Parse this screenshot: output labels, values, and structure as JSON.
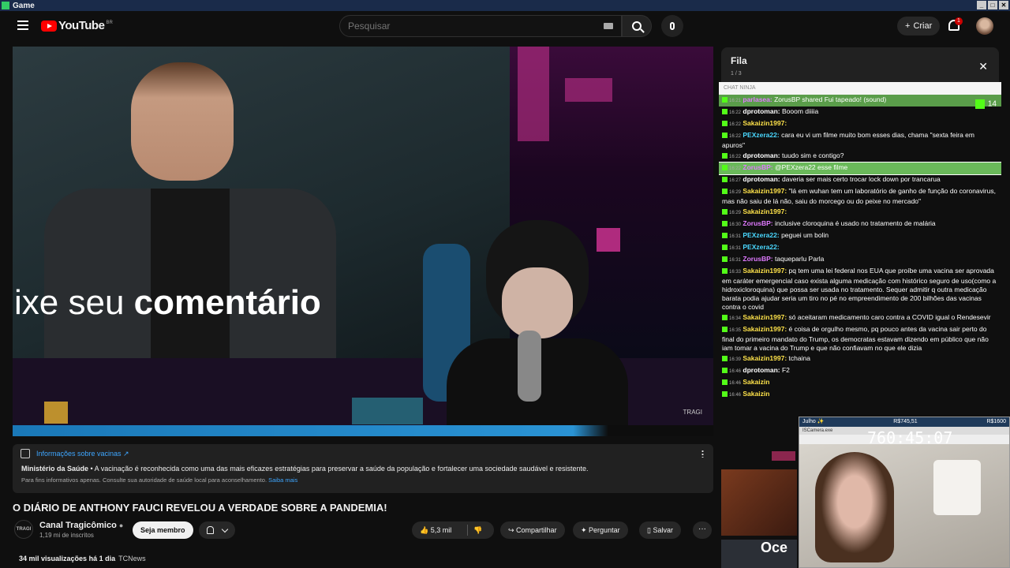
{
  "window": {
    "title": "Game"
  },
  "header": {
    "logo_text": "YouTube",
    "region": "BR",
    "search_placeholder": "Pesquisar",
    "create_label": "Criar",
    "notif_count": "1"
  },
  "video": {
    "overlay_text_regular": "ixe seu ",
    "overlay_text_bold": "comentário",
    "watermark": "TRAGI"
  },
  "vaccine_panel": {
    "link": "Informações sobre vacinas ↗",
    "source": "Ministério da Saúde",
    "text": " • A vacinação é reconhecida como uma das mais eficazes estratégias para preservar a saúde da população e fortalecer uma sociedade saudável e resistente.",
    "note": "Para fins informativos apenas. Consulte sua autoridade de saúde local para aconselhamento. ",
    "note_link": "Saiba mais"
  },
  "meta": {
    "title": "O DIÁRIO DE ANTHONY FAUCI REVELOU A VERDADE SOBRE A PANDEMIA!",
    "channel_avatar": "TRAGI",
    "channel": "Canal Tragicômico",
    "subscribers": "1,19 mi de inscritos",
    "member_button": "Seja membro",
    "likes": "5,3 mil",
    "share": "Compartilhar",
    "ask": "Perguntar",
    "save": "Salvar",
    "views": "34 mil visualizações",
    "age": "há 1 dia",
    "tag": "TCNews"
  },
  "queue": {
    "title": "Fila",
    "count": "1 / 3"
  },
  "chat": {
    "header": "CHAT NINJA",
    "badge_count": "14",
    "messages": [
      {
        "time": "16:21",
        "user": "parlasea:",
        "text": "ZorusBP shared Fui tapeado! (sound)"
      },
      {
        "time": "16:22",
        "user": "dprotoman:",
        "text": "Booom diiiia"
      },
      {
        "time": "16:22",
        "user": "Sakaizin1997:",
        "text": ""
      },
      {
        "time": "16:22",
        "user": "PEXzera22:",
        "text": "cara eu vi um filme muito bom esses dias, chama \"sexta feira em apuros\""
      },
      {
        "time": "16:22",
        "user": "dprotoman:",
        "text": "tuudo sim e contigo?"
      },
      {
        "time": "16:22",
        "user": "ZorusBP:",
        "text": "@PEXzera22 esse filme"
      },
      {
        "time": "16:27",
        "user": "dprotoman:",
        "text": "daveria ser mais certo trocar lock down por trancarua"
      },
      {
        "time": "16:29",
        "user": "Sakaizin1997:",
        "text": "\"lá em wuhan tem um laboratório de ganho de função do coronavirus, mas não saiu de lá não, saiu do morcego ou do peixe no mercado\""
      },
      {
        "time": "16:29",
        "user": "Sakaizin1997:",
        "text": ""
      },
      {
        "time": "16:30",
        "user": "ZorusBP:",
        "text": "inclusive cloroquina é usado no tratamento de malária"
      },
      {
        "time": "16:31",
        "user": "PEXzera22:",
        "text": "peguei um bolin"
      },
      {
        "time": "16:31",
        "user": "PEXzera22:",
        "text": ""
      },
      {
        "time": "16:31",
        "user": "ZorusBP:",
        "text": "taqueparlu Parla"
      },
      {
        "time": "16:33",
        "user": "Sakaizin1997:",
        "text": "pq tem uma lei federal nos EUA que proíbe uma vacina ser aprovada em caráter emergencial caso exista alguma medicação com histórico seguro de uso(como a hidroxicloroquina) que possa ser usada no tratamento. Sequer admitir q outra medicação barata podia ajudar seria um tiro no pé no empreendimento de 200 bilhões das vacinas contra o covid"
      },
      {
        "time": "16:34",
        "user": "Sakaizin1997:",
        "text": "só aceitaram medicamento caro contra a COVID igual o Rendesevir"
      },
      {
        "time": "16:35",
        "user": "Sakaizin1997:",
        "text": "é coisa de orgulho mesmo, pq pouco antes da vacina sair perto do final do primeiro mandato do Trump, os democratas estavam dizendo em público que não iam tomar a vacina do Trump e que não confiavam no que ele dizia"
      },
      {
        "time": "16:39",
        "user": "Sakaizin1997:",
        "text": "tchaina"
      },
      {
        "time": "16:46",
        "user": "dprotoman:",
        "text": "F2"
      },
      {
        "time": "16:46",
        "user": "Sakaizin",
        "text": ""
      },
      {
        "time": "16:46",
        "user": "Sakaizin",
        "text": ""
      }
    ]
  },
  "camera": {
    "month": "Julho ✨",
    "left_amount": "R$745,51",
    "right_amount": "R$1600",
    "app_title": "ISCamera.exe",
    "timer": "760:45:07"
  },
  "sidebar_thumb": {
    "title_fragment": "Oce"
  }
}
